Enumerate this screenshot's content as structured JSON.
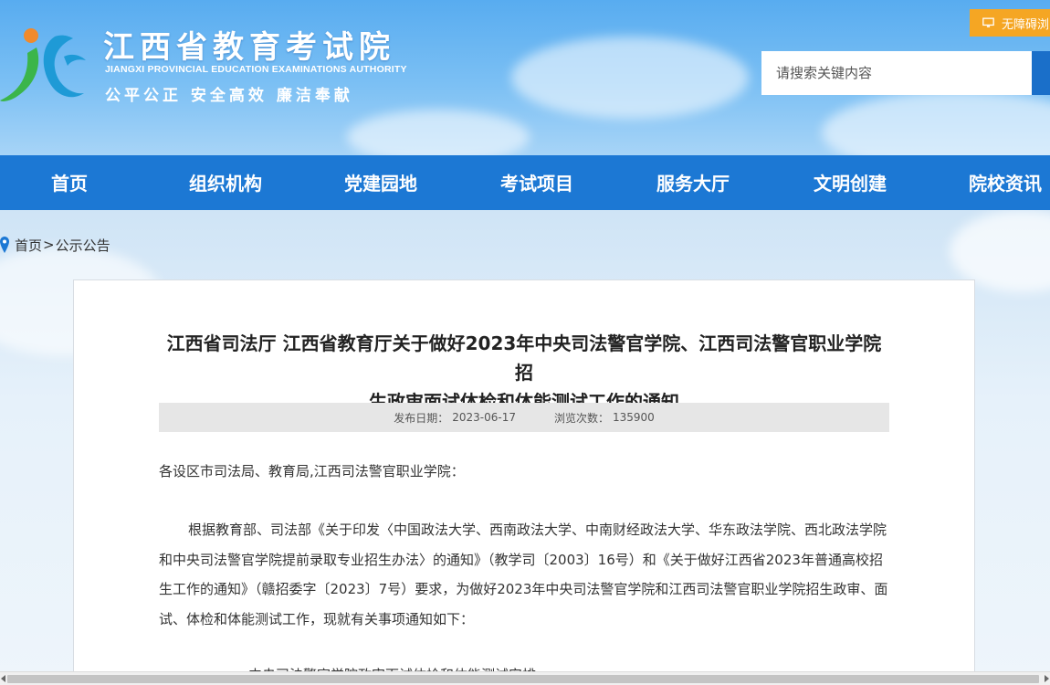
{
  "header": {
    "title": "江西省教育考试院",
    "english_name": "JIANGXI PROVINCIAL EDUCATION EXAMINATIONS AUTHORITY",
    "motto": "公平公正  安全高效  廉洁奉献",
    "logo_icon": "jx-logo-icon",
    "accessibility_label": "无障碍浏览",
    "accessibility_icon": "monitor-icon",
    "search_placeholder": "请搜索关键内容"
  },
  "nav": {
    "items": [
      {
        "label": "首页"
      },
      {
        "label": "组织机构"
      },
      {
        "label": "党建园地"
      },
      {
        "label": "考试项目"
      },
      {
        "label": "服务大厅"
      },
      {
        "label": "文明创建"
      },
      {
        "label": "院校资讯"
      }
    ]
  },
  "breadcrumb": {
    "icon": "location-pin-icon",
    "home": "首页",
    "separator": ">",
    "current": "公示公告"
  },
  "article": {
    "title_line1": "江西省司法厅 江西省教育厅关于做好2023年中央司法警官学院、江西司法警官职业学院招",
    "title_line2": "生政审面试体检和体能测试工作的通知",
    "date_label": "发布日期：",
    "date": "2023-06-17",
    "views_label": "浏览次数：",
    "views": "135900",
    "greeting": "各设区市司法局、教育局,江西司法警官职业学院：",
    "paragraph1": "根据教育部、司法部《关于印发〈中国政法大学、西南政法大学、中南财经政法大学、华东政法学院、西北政法学院和中央司法警官学院提前录取专业招生办法〉的通知》（教学司〔2003〕16号）和《关于做好江西省2023年普通高校招生工作的通知》（赣招委字〔2023〕7号）要求，为做好2023年中央司法警官学院和江西司法警官职业学院招生政审、面试、体检和体能测试工作，现就有关事项通知如下：",
    "paragraph2_partial": "一、中央司法警官学院政审面试体检和体能测试安排"
  },
  "colors": {
    "nav_bg": "#1c78d4",
    "accessibility_bg": "#f5a623",
    "meta_bg": "#e6e6e6"
  }
}
